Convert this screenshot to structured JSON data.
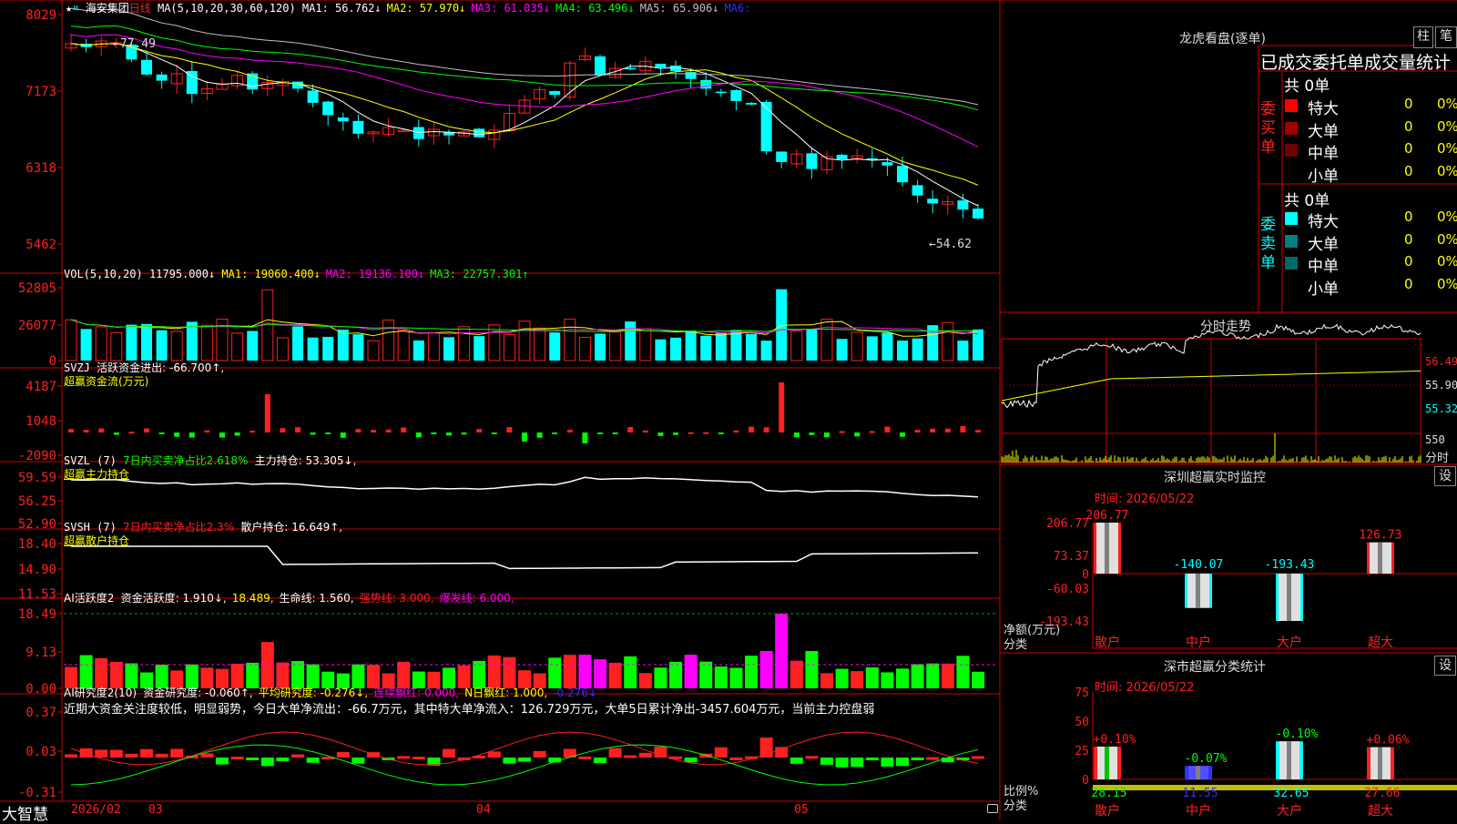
{
  "stock": {
    "name": "海安集团",
    "period": "日线"
  },
  "ma_panel": {
    "label": "MA(5,10,20,30,60,120)",
    "items": [
      {
        "label": "MA1: 56.762↓",
        "color": "#ffffff"
      },
      {
        "label": "MA2: 57.970↓",
        "color": "#ffff00"
      },
      {
        "label": "MA3: 61.035↓",
        "color": "#ff00ff"
      },
      {
        "label": "MA4: 63.496↓",
        "color": "#00ff00"
      },
      {
        "label": "MA5: 65.906↓",
        "color": "#c0c0c0"
      },
      {
        "label": "MA6:",
        "color": "#3030ff"
      }
    ],
    "yticks": [
      "8029",
      "7173",
      "6318",
      "5462"
    ],
    "high_note": "77.49",
    "low_note": "54.62"
  },
  "vol_panel": {
    "label": "VOL(5,10,20)",
    "value": "11795.000↓",
    "items": [
      {
        "label": "MA1: 19060.400↓",
        "color": "#ffff00"
      },
      {
        "label": "MA2: 19136.100↓",
        "color": "#ff00ff"
      },
      {
        "label": "MA3: 22757.301↑",
        "color": "#00ff00"
      }
    ],
    "yticks": [
      "52805",
      "26077",
      "0"
    ]
  },
  "svzj_panel": {
    "label": "SVZJ",
    "desc": "活跃资金进出: -66.700↑,",
    "sub": "超赢资金流(万元)",
    "yticks": [
      "4187",
      "1048",
      "-2090"
    ]
  },
  "svzl_panel": {
    "label": "SVZL (7)",
    "desc": "7日内买卖净占比2.618%",
    "desc2": "主力持仓: 53.305↓,",
    "sub": "超赢主力持仓",
    "yticks": [
      "59.59",
      "56.25",
      "52.90"
    ]
  },
  "svsh_panel": {
    "label": "SVSH (7)",
    "desc": "7日内买卖净占比2.3%",
    "desc2": "散户持仓: 16.649↑,",
    "sub": "超赢散户持仓",
    "yticks": [
      "18.40",
      "14.90",
      "11.53"
    ]
  },
  "ai_active_panel": {
    "label": "AI活跃度2",
    "items": [
      {
        "label": "资金活跃度: 1.910↓,",
        "color": "#ffffff"
      },
      {
        "label": "18.489,",
        "color": "#ffff00"
      },
      {
        "label": "生命线: 1.560,",
        "color": "#ffffff"
      },
      {
        "label": "强势线: 3.000,",
        "color": "#ff2020"
      },
      {
        "label": "爆发线: 6.000,",
        "color": "#ff00ff"
      }
    ],
    "yticks": [
      "18.49",
      "9.13",
      "0.00"
    ]
  },
  "ai_research_panel": {
    "label": "AI研究度2(10)",
    "items": [
      {
        "label": "资金研究度: -0.060↑,",
        "color": "#ffffff"
      },
      {
        "label": "平均研究度: -0.276↓,",
        "color": "#ffff00"
      },
      {
        "label": "连续飘红: 0.000,",
        "color": "#ff00ff"
      },
      {
        "label": "N日飘红: 1.000,",
        "color": "#ffff00"
      },
      {
        "label": "-0.276↓",
        "color": "#3030ff"
      }
    ],
    "comment": "近期大资金关注度较低，明显弱势，今日大单净流出：-66.7万元，其中特大单净流入：126.729万元，大单5日累计净出-3457.604万元，当前主力控盘弱",
    "yticks": [
      "0.37",
      "0.03",
      "-0.31"
    ]
  },
  "bottom_bar": {
    "brand": "大智慧",
    "dates": [
      "2026/02",
      "03",
      "04",
      "05"
    ]
  },
  "dragon_tiger": {
    "title": "龙虎看盘(逐单)",
    "btn_bar": "柱",
    "btn_pen": "笔",
    "header": "已成交委托单成交量统计",
    "buy": {
      "side": "委买单",
      "total": "共 0单",
      "rows": [
        {
          "label": "特大",
          "count": "0",
          "pct": "0%",
          "color": "#ff0000"
        },
        {
          "label": "大单",
          "count": "0",
          "pct": "0%",
          "color": "#a00000"
        },
        {
          "label": "中单",
          "count": "0",
          "pct": "0%",
          "color": "#700000"
        },
        {
          "label": "小单",
          "count": "0",
          "pct": "0%",
          "color": ""
        }
      ]
    },
    "sell": {
      "side": "委卖单",
      "total": "共 0单",
      "rows": [
        {
          "label": "特大",
          "count": "0",
          "pct": "0%",
          "color": "#00ffff"
        },
        {
          "label": "大单",
          "count": "0",
          "pct": "0%",
          "color": "#008080"
        },
        {
          "label": "中单",
          "count": "0",
          "pct": "0%",
          "color": "#006a6a"
        },
        {
          "label": "小单",
          "count": "0",
          "pct": "0%",
          "color": ""
        }
      ]
    }
  },
  "intraday": {
    "title": "分时走势",
    "prices": [
      "56.49",
      "55.90",
      "55.32"
    ],
    "vol_top": "550",
    "vol_label": "分时"
  },
  "monitor": {
    "title": "深圳超赢实时监控",
    "btn": "设",
    "time": "时间: 2026/05/22",
    "yticks": [
      "206.77",
      "73.37",
      "0",
      "-60.03",
      "-193.43"
    ],
    "unit_label": "净额(万元)",
    "cat_label": "分类",
    "bars": [
      {
        "name": "散户",
        "value": 206.77,
        "label": "206.77"
      },
      {
        "name": "中户",
        "value": -140.07,
        "label": "-140.07"
      },
      {
        "name": "大户",
        "value": -193.43,
        "label": "-193.43"
      },
      {
        "name": "超大",
        "value": 126.73,
        "label": "126.73"
      }
    ]
  },
  "classify": {
    "title": "深市超赢分类统计",
    "btn": "设",
    "time": "时间: 2026/05/22",
    "yticks": [
      "75",
      "50",
      "25",
      "0"
    ],
    "ratio_label": "比例%",
    "cat_label": "分类",
    "bars": [
      {
        "name": "散户",
        "value": 28.15,
        "label": "28.15",
        "change": "+0.10%"
      },
      {
        "name": "中户",
        "value": 11.55,
        "label": "11.55",
        "change": "-0.07%"
      },
      {
        "name": "大户",
        "value": 32.65,
        "label": "32.65",
        "change": "-0.10%"
      },
      {
        "name": "超大",
        "value": 27.66,
        "label": "27.66",
        "change": "+0.06%"
      }
    ]
  },
  "colors": {
    "up": "#ff2020",
    "down": "#00ffff",
    "frame": "#d00000",
    "grid": "#400000"
  }
}
